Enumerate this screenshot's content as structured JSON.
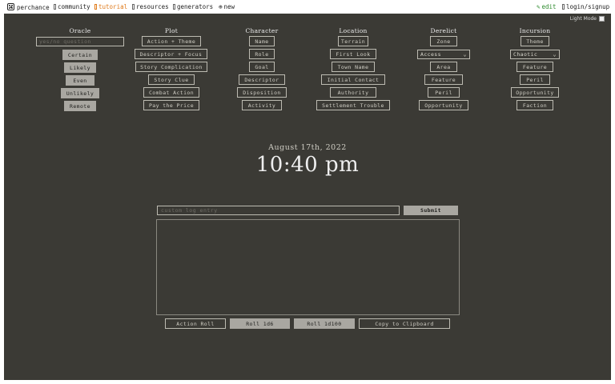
{
  "nav": {
    "brand": "perchance",
    "community": "community",
    "tutorial": "tutorial",
    "resources": "resources",
    "generators": "generators",
    "new": "new",
    "edit": "edit",
    "login": "login/signup"
  },
  "light_mode_label": "Light Mode",
  "columns": {
    "oracle": {
      "title": "Oracle",
      "input_placeholder": "yes/no question",
      "buttons": [
        "Certain",
        "Likely",
        "Even",
        "Unlikely",
        "Remote"
      ]
    },
    "plot": {
      "title": "Plot",
      "buttons": [
        "Action + Theme",
        "Descriptor + Focus",
        "Story Complication",
        "Story Clue",
        "Combat Action",
        "Pay the Price"
      ]
    },
    "character": {
      "title": "Character",
      "buttons": [
        "Name",
        "Role",
        "Goal",
        "Descriptor",
        "Disposition",
        "Activity"
      ]
    },
    "location": {
      "title": "Location",
      "buttons": [
        "Terrain",
        "First Look",
        "Town Name",
        "Initial Contact",
        "Authority",
        "Settlement Trouble"
      ]
    },
    "derelict": {
      "title": "Derelict",
      "zone_button": "Zone",
      "select_value": "Access",
      "buttons": [
        "Area",
        "Feature",
        "Peril",
        "Opportunity"
      ]
    },
    "incursion": {
      "title": "Incursion",
      "theme_button": "Theme",
      "select_value": "Chaotic",
      "buttons": [
        "Feature",
        "Peril",
        "Opportunity",
        "Faction"
      ]
    }
  },
  "clock": {
    "date": "August 17th, 2022",
    "time": "10:40 pm"
  },
  "log": {
    "input_placeholder": "custom log entry",
    "submit_label": "Submit",
    "content": ""
  },
  "bottom_buttons": {
    "action_roll": "Action Roll",
    "roll_1d6": "Roll 1d6",
    "roll_1d100": "Roll 1d100",
    "copy": "Copy to Clipboard"
  },
  "colors": {
    "panel_bg": "#3b3a35",
    "tutorial_accent": "#e07a1a",
    "edit_accent": "#2e8b2e"
  }
}
